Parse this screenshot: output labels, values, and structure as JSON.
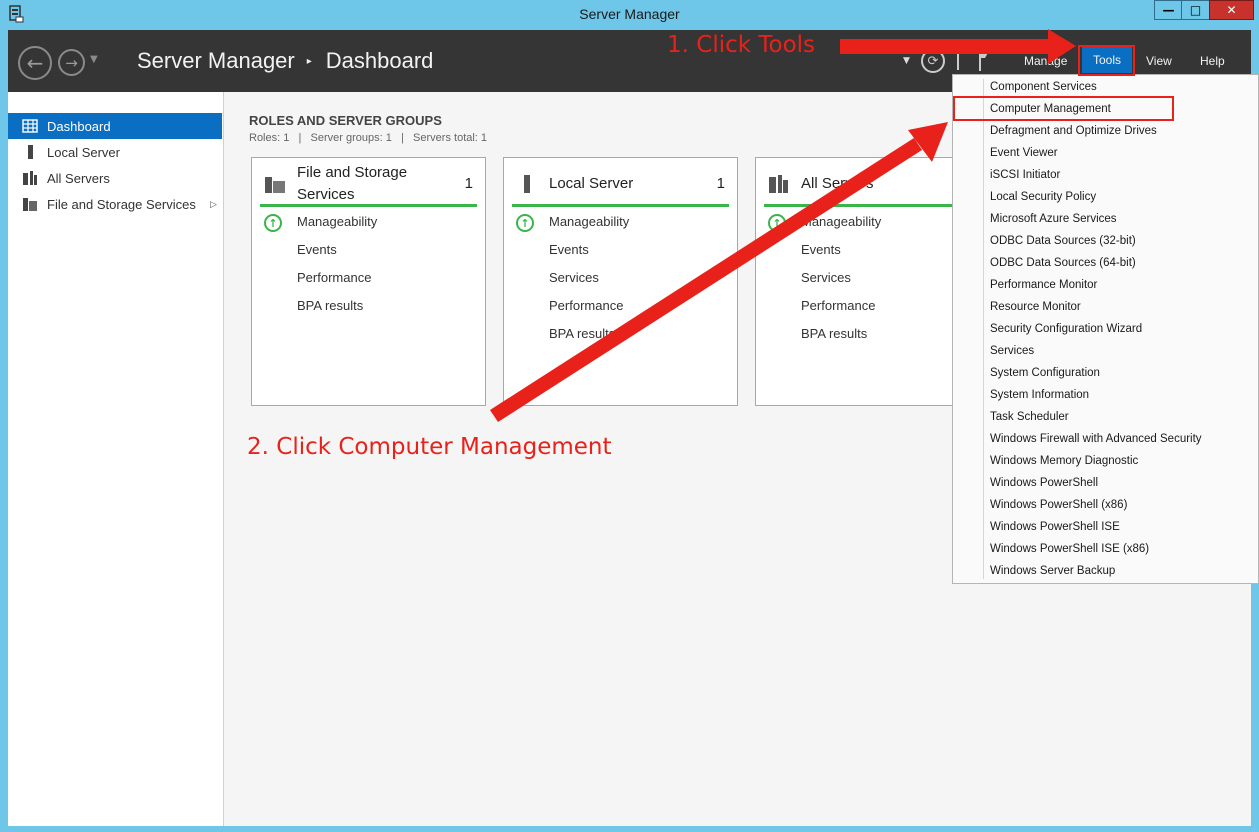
{
  "window": {
    "title": "Server Manager",
    "minimize_label": "—",
    "maximize_label": "□",
    "close_label": "✕"
  },
  "header": {
    "breadcrumb_root": "Server Manager",
    "breadcrumb_separator": "▸",
    "breadcrumb_page": "Dashboard",
    "menus": {
      "manage": "Manage",
      "tools": "Tools",
      "view": "View",
      "help": "Help"
    }
  },
  "sidebar": {
    "items": [
      {
        "label": "Dashboard",
        "icon": "dashboard-icon",
        "active": true
      },
      {
        "label": "Local Server",
        "icon": "server-icon"
      },
      {
        "label": "All Servers",
        "icon": "servers-icon"
      },
      {
        "label": "File and Storage Services",
        "icon": "file-storage-icon"
      }
    ]
  },
  "main": {
    "section_title": "ROLES AND SERVER GROUPS",
    "section_sub": "Roles: 1   |   Server groups: 1   |   Servers total: 1",
    "cards": [
      {
        "title_line1": "File and Storage",
        "title_line2": "Services",
        "count": "1",
        "rows": [
          "Manageability",
          "Events",
          "Performance",
          "BPA results"
        ]
      },
      {
        "title_line1": "Local Server",
        "count": "1",
        "rows": [
          "Manageability",
          "Events",
          "Services",
          "Performance",
          "BPA results"
        ]
      },
      {
        "title_line1": "All Servers",
        "rows": [
          "Manageability",
          "Events",
          "Services",
          "Performance",
          "BPA results"
        ]
      }
    ]
  },
  "tools_menu": {
    "items": [
      "Component Services",
      "Computer Management",
      "Defragment and Optimize Drives",
      "Event Viewer",
      "iSCSI Initiator",
      "Local Security Policy",
      "Microsoft Azure Services",
      "ODBC Data Sources (32-bit)",
      "ODBC Data Sources (64-bit)",
      "Performance Monitor",
      "Resource Monitor",
      "Security Configuration Wizard",
      "Services",
      "System Configuration",
      "System Information",
      "Task Scheduler",
      "Windows Firewall with Advanced Security",
      "Windows Memory Diagnostic",
      "Windows PowerShell",
      "Windows PowerShell (x86)",
      "Windows PowerShell ISE",
      "Windows PowerShell ISE (x86)",
      "Windows Server Backup"
    ]
  },
  "annotations": {
    "step1": "1. Click Tools",
    "step2": "2. Click Computer Management",
    "color": "#e8221a"
  },
  "colors": {
    "accent": "#0a6fc2",
    "header_bg": "#353535",
    "window_frame": "#6ec6e8",
    "status_green": "#3ab54a"
  }
}
